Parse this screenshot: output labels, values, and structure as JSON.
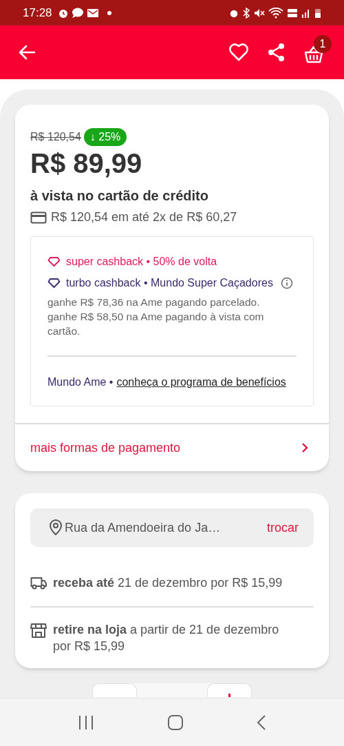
{
  "status_bar": {
    "time": "17:28"
  },
  "app_bar": {
    "cart_count": "1"
  },
  "price": {
    "old": "R$ 120,54",
    "discount": "↓ 25%",
    "current": "R$ 89,99",
    "condition": "à vista no cartão de crédito",
    "installments": "R$ 120,54 em até 2x de R$ 60,27"
  },
  "cashback": {
    "offers": [
      {
        "label": "super cashback • 50% de volta",
        "color": "#e0195a",
        "info": false
      },
      {
        "label": "turbo cashback • Mundo Super Caçadores",
        "color": "#3b2a6b",
        "info": true
      }
    ],
    "notes": [
      "ganhe R$ 78,36 na Ame pagando parcelado.",
      "ganhe R$ 58,50 na Ame pagando à vista com cartão."
    ],
    "program": {
      "prefix": "Mundo Ame •",
      "link": "conheça o programa de benefícios"
    }
  },
  "more_payment": "mais formas de pagamento",
  "delivery": {
    "address": "Rua da Amendoeira do Ja…",
    "change": "trocar",
    "options": [
      {
        "kind": "shipping",
        "text": "**receba até** 21 de dezembro por R$ 15,99"
      },
      {
        "kind": "pickup",
        "text": "**retire na loja** a partir de 21 de dezembro por R$ 15,99"
      }
    ]
  }
}
